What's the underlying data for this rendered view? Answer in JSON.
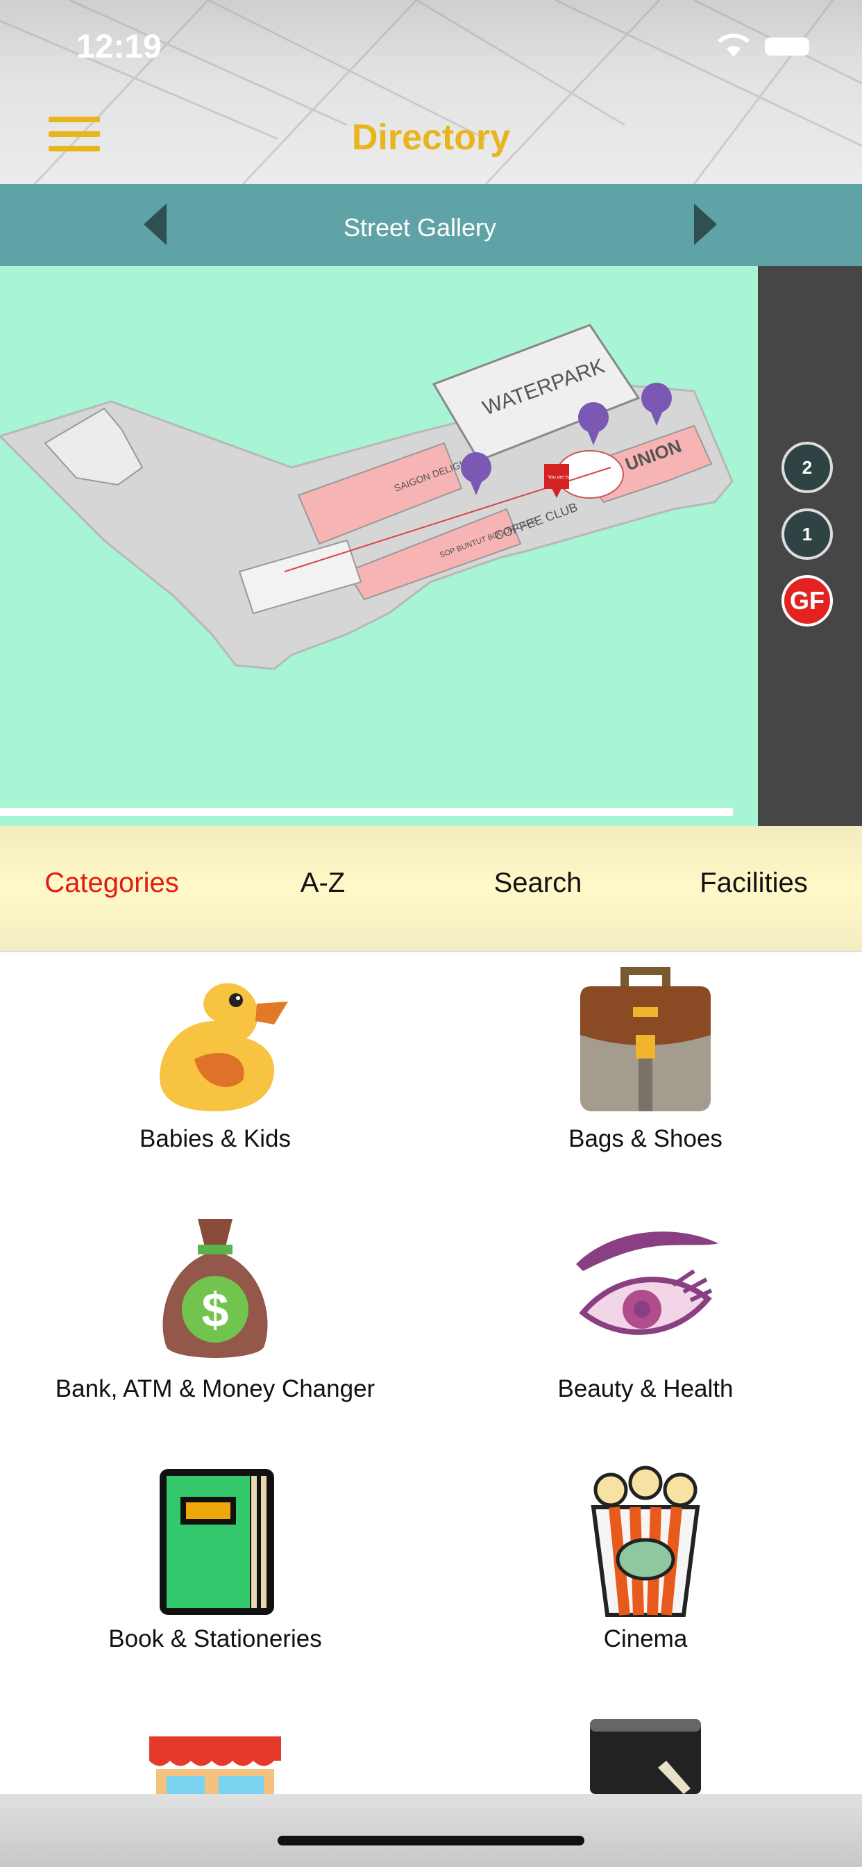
{
  "status": {
    "time": "12:19"
  },
  "header": {
    "title": "Directory"
  },
  "subnav": {
    "label": "Street Gallery"
  },
  "map": {
    "labels": {
      "waterpark": "WATERPARK",
      "union": "UNION",
      "saigon": "SAIGON DELIGHT",
      "coffee": "COFFEE CLUB",
      "sop": "SOP BUNTUT BOGOR CAFE",
      "here": "You are here"
    }
  },
  "floors": [
    {
      "label": "2"
    },
    {
      "label": "1"
    },
    {
      "label": "GF",
      "active": true
    }
  ],
  "tabs": [
    {
      "label": "Categories",
      "active": true
    },
    {
      "label": "A-Z"
    },
    {
      "label": "Search"
    },
    {
      "label": "Facilities"
    }
  ],
  "categories": [
    {
      "label": "Babies & Kids",
      "icon": "duck-icon"
    },
    {
      "label": "Bags & Shoes",
      "icon": "briefcase-icon"
    },
    {
      "label": "Bank, ATM & Money Changer",
      "icon": "money-bag-icon"
    },
    {
      "label": "Beauty & Health",
      "icon": "eye-icon"
    },
    {
      "label": "Book & Stationeries",
      "icon": "book-icon"
    },
    {
      "label": "Cinema",
      "icon": "popcorn-icon"
    },
    {
      "label": "",
      "icon": "store-icon"
    },
    {
      "label": "",
      "icon": "tablet-icon"
    }
  ],
  "colors": {
    "accent": "#e9b51d",
    "teal": "#5fa3a6",
    "map_bg": "#a8f5d6",
    "active_tab": "#e21d10"
  }
}
